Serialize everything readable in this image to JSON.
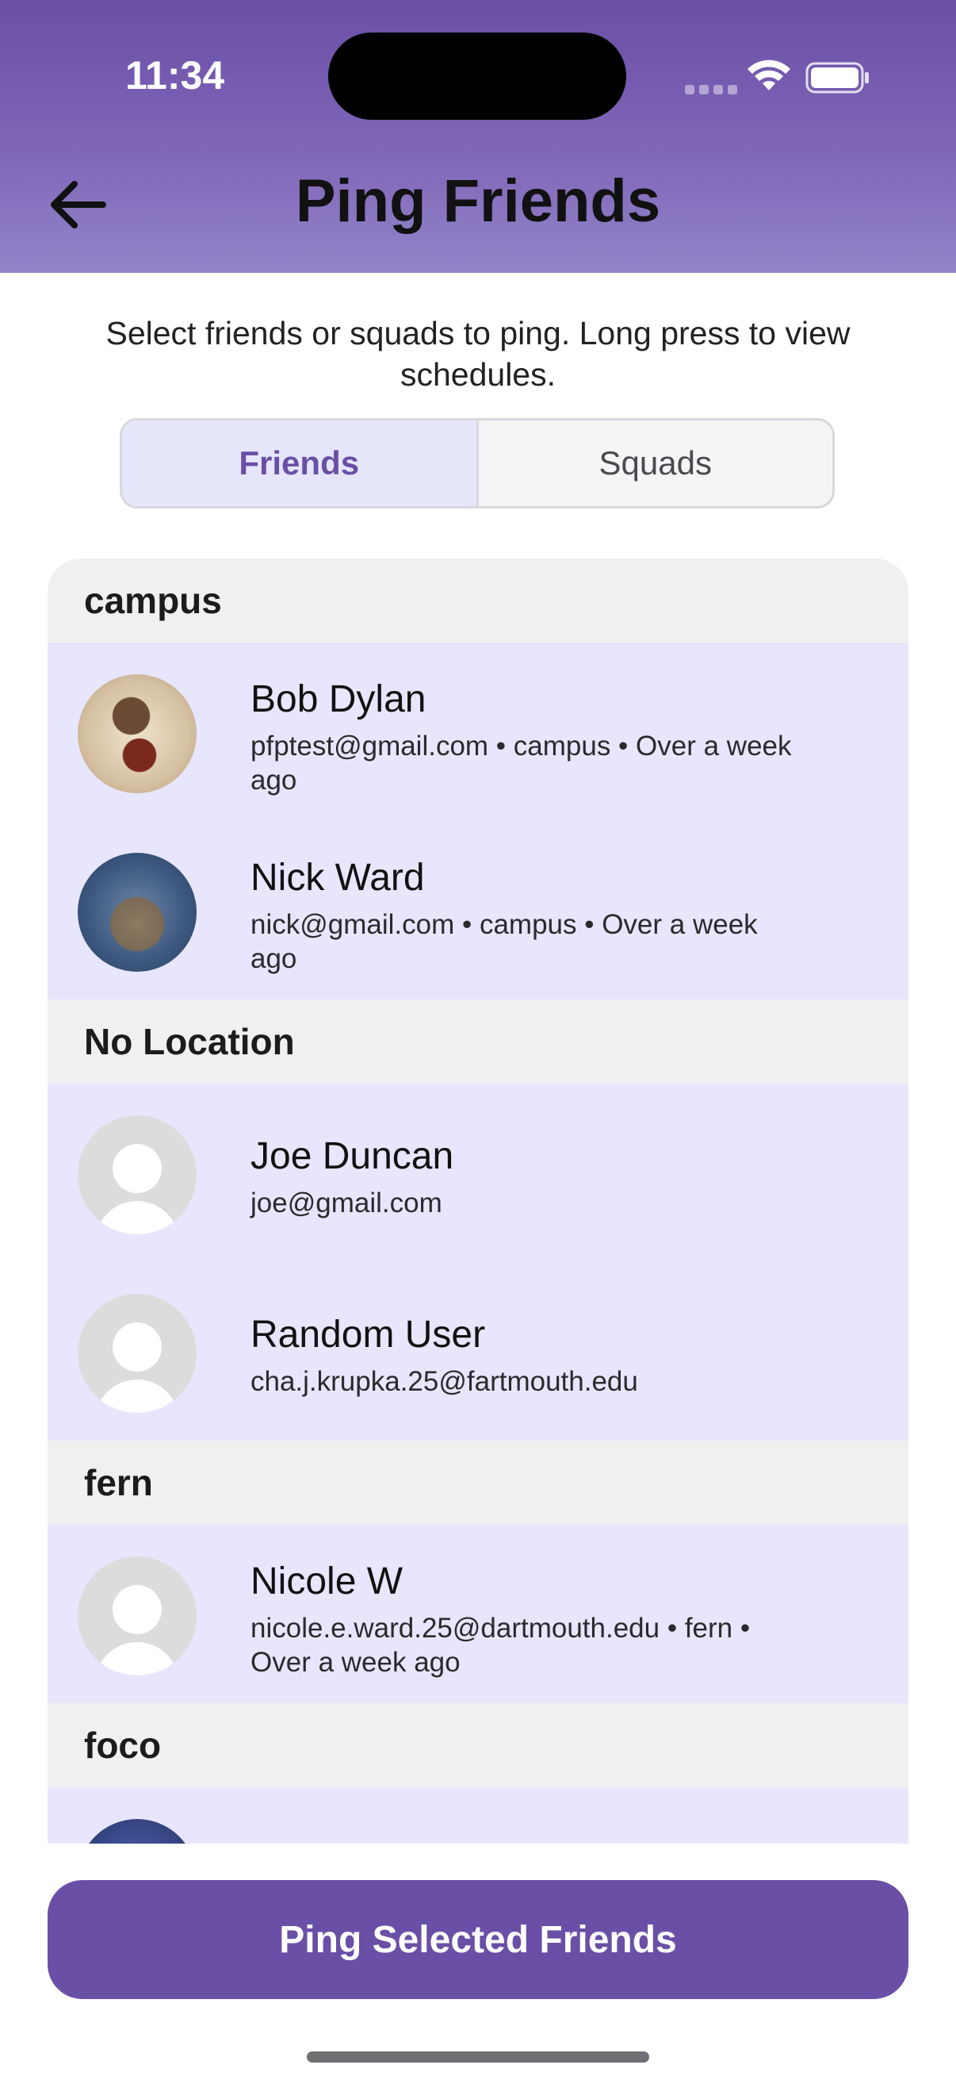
{
  "status_bar": {
    "time": "11:34"
  },
  "header": {
    "title": "Ping Friends"
  },
  "instructions": "Select friends or squads to ping. Long press to view schedules.",
  "tabs": [
    {
      "label": "Friends",
      "active": true
    },
    {
      "label": "Squads",
      "active": false
    }
  ],
  "sections": [
    {
      "title": "campus",
      "friends": [
        {
          "name": "Bob Dylan",
          "detail": "pfptest@gmail.com • campus • Over a week ago",
          "avatar": "photo"
        },
        {
          "name": "Nick Ward",
          "detail": "nick@gmail.com • campus • Over a week ago",
          "avatar": "photo"
        }
      ]
    },
    {
      "title": "No Location",
      "friends": [
        {
          "name": "Joe Duncan",
          "detail": "joe@gmail.com",
          "avatar": "placeholder"
        },
        {
          "name": "Random User",
          "detail": "cha.j.krupka.25@fartmouth.edu",
          "avatar": "placeholder"
        }
      ]
    },
    {
      "title": "fern",
      "friends": [
        {
          "name": "Nicole W",
          "detail": "nicole.e.ward.25@dartmouth.edu • fern • Over a week ago",
          "avatar": "placeholder"
        }
      ]
    },
    {
      "title": "foco",
      "friends": [
        {
          "name": "",
          "detail": "",
          "avatar": "photo"
        }
      ]
    }
  ],
  "ping_button": {
    "label": "Ping Selected Friends"
  },
  "colors": {
    "accent": "#6a4fa6",
    "row_background": "#e7e6fc",
    "section_background": "#f0f0f0"
  }
}
